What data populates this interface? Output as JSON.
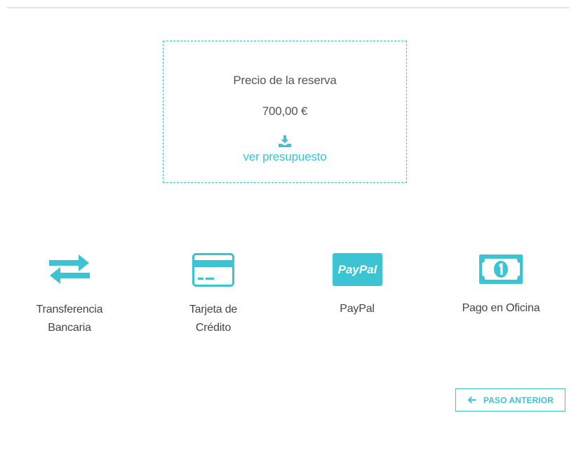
{
  "price": {
    "title": "Precio de la reserva",
    "amount": "700,00 €",
    "download_link": "ver presupuesto"
  },
  "payment_methods": [
    {
      "icon": "transfer-arrows-icon",
      "label_line1": "Transferencia",
      "label_line2": "Bancaria"
    },
    {
      "icon": "credit-card-icon",
      "label_line1": "Tarjeta de",
      "label_line2": "Crédito"
    },
    {
      "icon": "paypal-icon",
      "label_line1": "PayPal",
      "label_line2": "",
      "logo_text": "PayPal"
    },
    {
      "icon": "cash-bill-icon",
      "label_line1": "Pago en Oficina",
      "label_line2": ""
    }
  ],
  "navigation": {
    "back_label": "PASO ANTERIOR",
    "back_icon": "arrow-left-icon"
  },
  "colors": {
    "accent": "#3cc3d4",
    "text": "#4a4a4a",
    "divider": "#e3e3e3"
  }
}
